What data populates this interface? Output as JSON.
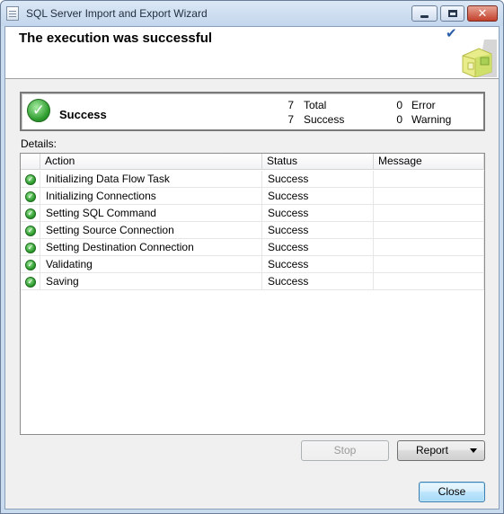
{
  "window": {
    "title": "SQL Server Import and Export Wizard"
  },
  "header": {
    "heading": "The execution was successful"
  },
  "summary": {
    "status": "Success",
    "total_count": "7",
    "total_label": "Total",
    "success_count": "7",
    "success_label": "Success",
    "error_count": "0",
    "error_label": "Error",
    "warning_count": "0",
    "warning_label": "Warning"
  },
  "details": {
    "label": "Details:",
    "columns": [
      "Action",
      "Status",
      "Message"
    ],
    "rows": [
      {
        "action": "Initializing Data Flow Task",
        "status": "Success",
        "message": ""
      },
      {
        "action": "Initializing Connections",
        "status": "Success",
        "message": ""
      },
      {
        "action": "Setting SQL Command",
        "status": "Success",
        "message": ""
      },
      {
        "action": "Setting Source Connection",
        "status": "Success",
        "message": ""
      },
      {
        "action": "Setting Destination Connection",
        "status": "Success",
        "message": ""
      },
      {
        "action": "Validating",
        "status": "Success",
        "message": ""
      },
      {
        "action": "Saving",
        "status": "Success",
        "message": ""
      }
    ]
  },
  "buttons": {
    "stop": "Stop",
    "report": "Report",
    "close": "Close"
  },
  "colors": {
    "success_green": "#2e9c2e",
    "accent_blue": "#2a5ea8",
    "title_bar": "#c9dbee"
  },
  "icons": {
    "success": "check-circle-icon",
    "header": "checkmark-icon",
    "app": "document-icon"
  }
}
